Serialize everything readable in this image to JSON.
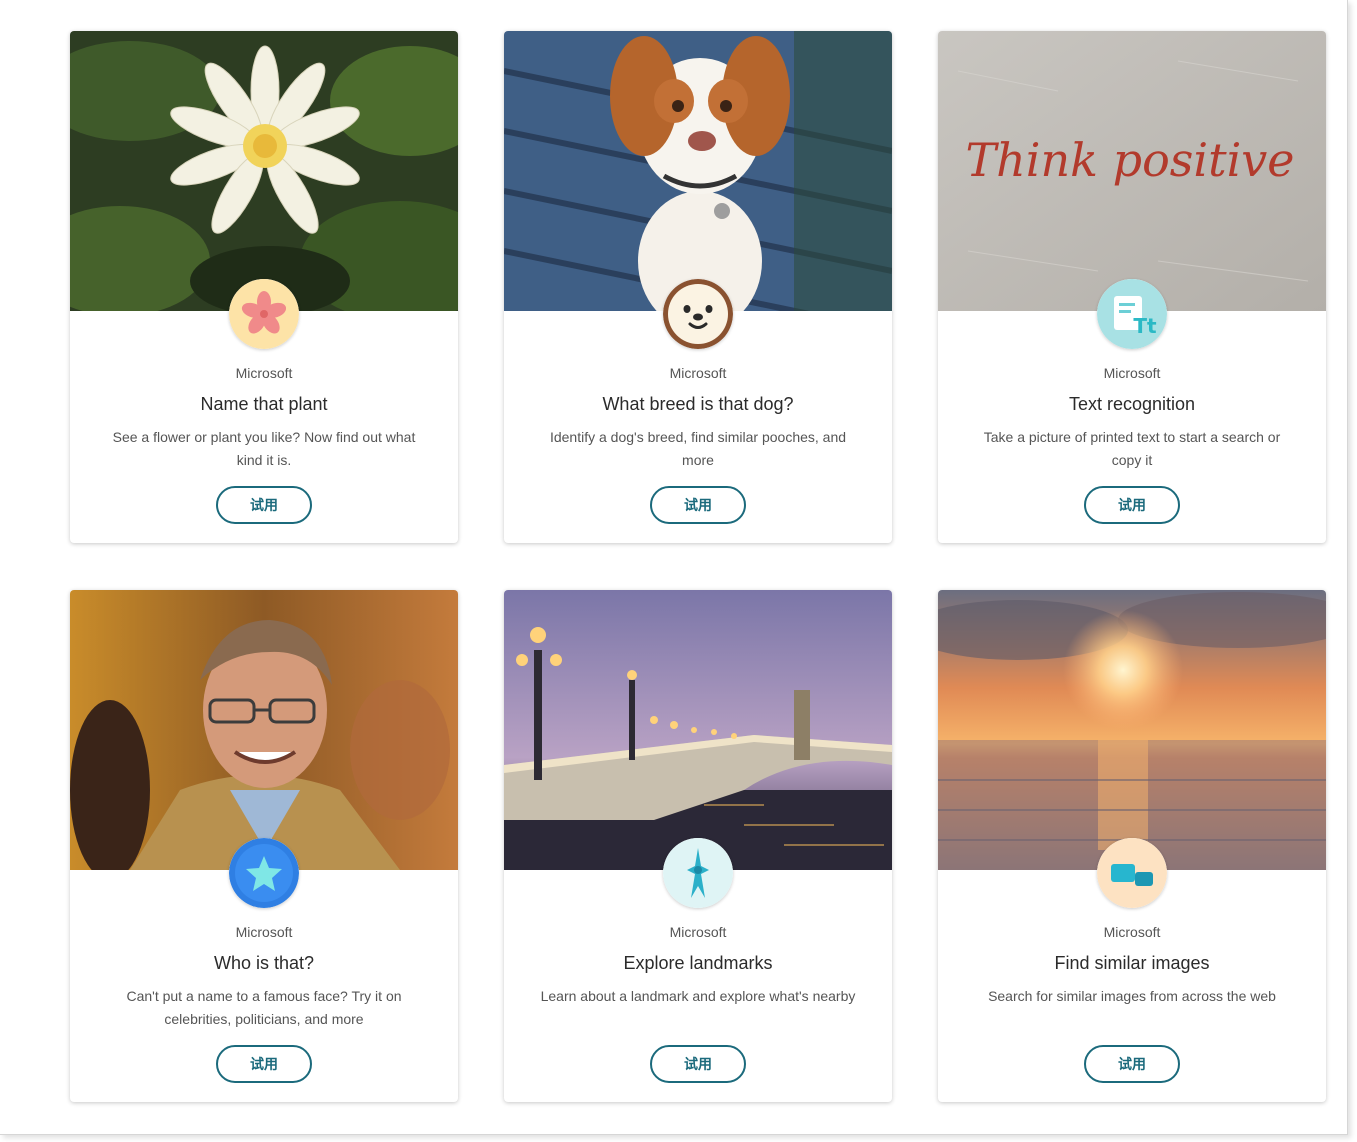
{
  "cards": [
    {
      "publisher": "Microsoft",
      "title": "Name that plant",
      "description": "See a flower or plant you like? Now find out what kind it is.",
      "button": "试用",
      "image": "water-lily-photo",
      "icon": "flower-icon"
    },
    {
      "publisher": "Microsoft",
      "title": "What breed is that dog?",
      "description": "Identify a dog's breed, find similar pooches, and more",
      "button": "试用",
      "image": "puppy-photo",
      "icon": "dog-face-icon"
    },
    {
      "publisher": "Microsoft",
      "title": "Text recognition",
      "description": "Take a picture of printed text to start a search or copy it",
      "button": "试用",
      "image": "handwritten-text-photo",
      "icon": "text-recognition-icon",
      "image_text": "Think positive"
    },
    {
      "publisher": "Microsoft",
      "title": "Who is that?",
      "description": "Can't put a name to a famous face? Try it on celebrities, politicians, and more",
      "button": "试用",
      "image": "smiling-man-photo",
      "icon": "star-icon"
    },
    {
      "publisher": "Microsoft",
      "title": "Explore landmarks",
      "description": "Learn about a landmark and explore what's nearby",
      "button": "试用",
      "image": "bridge-at-dusk-photo",
      "icon": "landmark-tower-icon"
    },
    {
      "publisher": "Microsoft",
      "title": "Find similar images",
      "description": "Search for similar images from across the web",
      "button": "试用",
      "image": "ocean-sunset-photo",
      "icon": "similar-images-icon"
    }
  ],
  "colors": {
    "button_border": "#1b6a7c",
    "title_text": "#2b2b2b",
    "body_text": "#555555"
  }
}
